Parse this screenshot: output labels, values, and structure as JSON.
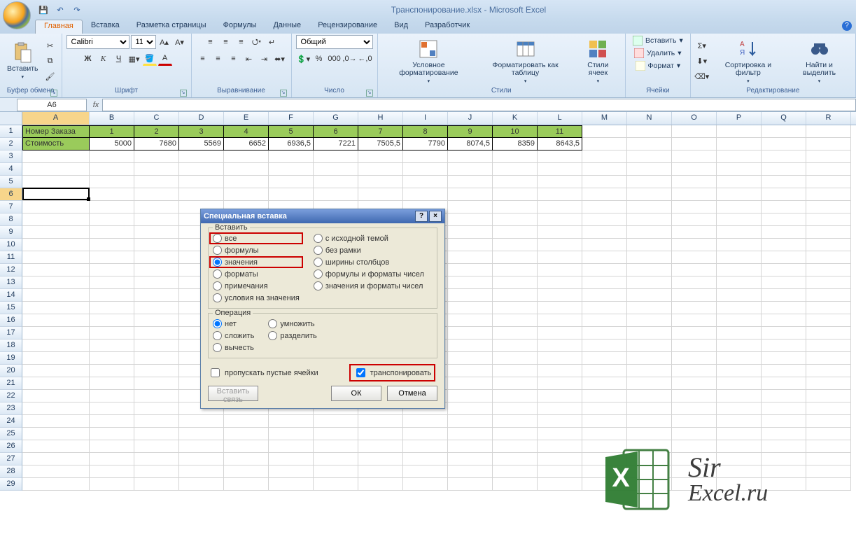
{
  "titlebar": {
    "document": "Транспонирование.xlsx",
    "app": "Microsoft Excel"
  },
  "qat": {
    "save": "💾",
    "undo": "↶",
    "redo": "↷"
  },
  "tabs": [
    "Главная",
    "Вставка",
    "Разметка страницы",
    "Формулы",
    "Данные",
    "Рецензирование",
    "Вид",
    "Разработчик"
  ],
  "ribbon": {
    "clipboard": {
      "label": "Буфер обмена",
      "paste": "Вставить"
    },
    "font": {
      "label": "Шрифт",
      "name": "Calibri",
      "size": "11",
      "bold": "Ж",
      "italic": "К",
      "underline": "Ч"
    },
    "align": {
      "label": "Выравнивание"
    },
    "number": {
      "label": "Число",
      "format": "Общий"
    },
    "styles": {
      "label": "Стили",
      "cond": "Условное форматирование",
      "table": "Форматировать как таблицу",
      "cell": "Стили ячеек"
    },
    "cells": {
      "label": "Ячейки",
      "insert": "Вставить",
      "delete": "Удалить",
      "format": "Формат"
    },
    "editing": {
      "label": "Редактирование",
      "sort": "Сортировка и фильтр",
      "find": "Найти и выделить"
    }
  },
  "namebox": "A6",
  "columns": [
    "A",
    "B",
    "C",
    "D",
    "E",
    "F",
    "G",
    "H",
    "I",
    "J",
    "K",
    "L",
    "M",
    "N",
    "O",
    "P",
    "Q",
    "R"
  ],
  "row1": {
    "label": "Номер Заказа",
    "vals": [
      "1",
      "2",
      "3",
      "4",
      "5",
      "6",
      "7",
      "8",
      "9",
      "10",
      "11"
    ]
  },
  "row2": {
    "label": "Стоимость",
    "vals": [
      "5000",
      "7680",
      "5569",
      "6652",
      "6936,5",
      "7221",
      "7505,5",
      "7790",
      "8074,5",
      "8359",
      "8643,5"
    ]
  },
  "dialog": {
    "title": "Специальная вставка",
    "group_paste": "Вставить",
    "paste_left": [
      "все",
      "формулы",
      "значения",
      "форматы",
      "примечания",
      "условия на значения"
    ],
    "paste_right": [
      "с исходной темой",
      "без рамки",
      "ширины столбцов",
      "формулы и форматы чисел",
      "значения и форматы чисел"
    ],
    "group_op": "Операция",
    "op_left": [
      "нет",
      "сложить",
      "вычесть"
    ],
    "op_right": [
      "умножить",
      "разделить"
    ],
    "skip": "пропускать пустые ячейки",
    "transpose": "транспонировать",
    "link": "Вставить связь",
    "ok": "ОК",
    "cancel": "Отмена"
  },
  "watermark": {
    "line1": "Sir",
    "line2": "Excel.ru"
  }
}
